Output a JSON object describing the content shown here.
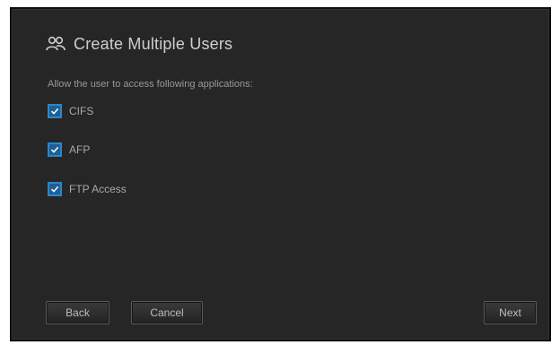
{
  "dialog": {
    "title": "Create Multiple Users",
    "icon": "users-icon",
    "instruction": "Allow the user to access following applications:",
    "options": [
      {
        "label": "CIFS",
        "checked": true
      },
      {
        "label": "AFP",
        "checked": true
      },
      {
        "label": "FTP Access",
        "checked": true
      }
    ],
    "buttons": {
      "back": "Back",
      "cancel": "Cancel",
      "next": "Next"
    },
    "colors": {
      "background": "#262626",
      "checkbox_accent": "#2c86c8"
    }
  }
}
